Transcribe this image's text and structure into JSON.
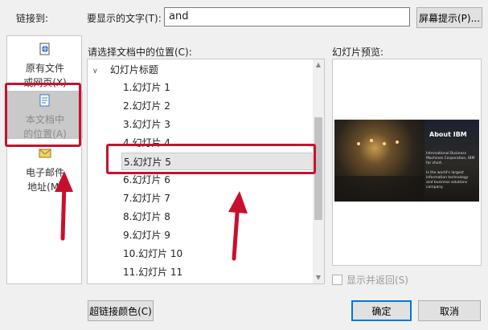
{
  "link_to_label": "链接到:",
  "display_text": {
    "label": "要显示的文字(T):",
    "value": "and"
  },
  "screen_tip_button": "屏幕提示(P)...",
  "sidebar": {
    "items": [
      {
        "label": "原有文件\n或网页(X)",
        "icon": "globe-page-icon"
      },
      {
        "label": "本文档中\n的位置(A)",
        "icon": "document-place-icon"
      },
      {
        "label": "电子邮件\n地址(M)",
        "icon": "email-icon"
      }
    ]
  },
  "location_label": "请选择文档中的位置(C):",
  "tree": {
    "group_label": "幻灯片标题",
    "slides": [
      "1.幻灯片 1",
      "2.幻灯片 2",
      "3.幻灯片 3",
      "4.幻灯片 4",
      "5.幻灯片 5",
      "6.幻灯片 6",
      "7.幻灯片 7",
      "8.幻灯片 8",
      "9.幻灯片 9",
      "10.幻灯片 10",
      "11.幻灯片 11"
    ],
    "selected_index": 4
  },
  "preview": {
    "label": "幻灯片预览:",
    "title": "About IBM",
    "text1": "International Business Machines Corporation, IBM for short.",
    "text2": "Is the world's largest information technology and business solutions company."
  },
  "show_return_checkbox": {
    "label": "显示并返回(S)",
    "checked": false
  },
  "hyperlink_color_button": "超链接颜色(C)",
  "ok_button": "确定",
  "cancel_button": "取消",
  "colors": {
    "highlight_red": "#c8102e",
    "accent": "#0078d7"
  }
}
